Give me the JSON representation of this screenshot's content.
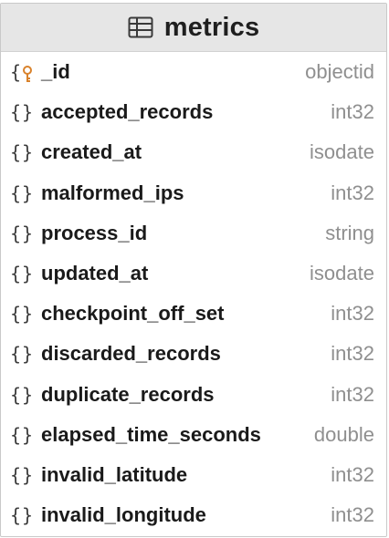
{
  "table": {
    "name": "metrics",
    "icon": "table-icon",
    "fields": [
      {
        "name": "_id",
        "type": "objectid",
        "icon": "key-brace-icon",
        "is_key": true
      },
      {
        "name": "accepted_records",
        "type": "int32",
        "icon": "brace-icon",
        "is_key": false
      },
      {
        "name": "created_at",
        "type": "isodate",
        "icon": "brace-icon",
        "is_key": false
      },
      {
        "name": "malformed_ips",
        "type": "int32",
        "icon": "brace-icon",
        "is_key": false
      },
      {
        "name": "process_id",
        "type": "string",
        "icon": "brace-icon",
        "is_key": false
      },
      {
        "name": "updated_at",
        "type": "isodate",
        "icon": "brace-icon",
        "is_key": false
      },
      {
        "name": "checkpoint_off_set",
        "type": "int32",
        "icon": "brace-icon",
        "is_key": false
      },
      {
        "name": "discarded_records",
        "type": "int32",
        "icon": "brace-icon",
        "is_key": false
      },
      {
        "name": "duplicate_records",
        "type": "int32",
        "icon": "brace-icon",
        "is_key": false
      },
      {
        "name": "elapsed_time_seconds",
        "type": "double",
        "icon": "brace-icon",
        "is_key": false
      },
      {
        "name": "invalid_latitude",
        "type": "int32",
        "icon": "brace-icon",
        "is_key": false
      },
      {
        "name": "invalid_longitude",
        "type": "int32",
        "icon": "brace-icon",
        "is_key": false
      }
    ]
  },
  "colors": {
    "header_bg": "#e6e6e6",
    "key_icon": "#d9822b",
    "type_text": "#8f8f8f",
    "name_text": "#1a1a1a"
  }
}
